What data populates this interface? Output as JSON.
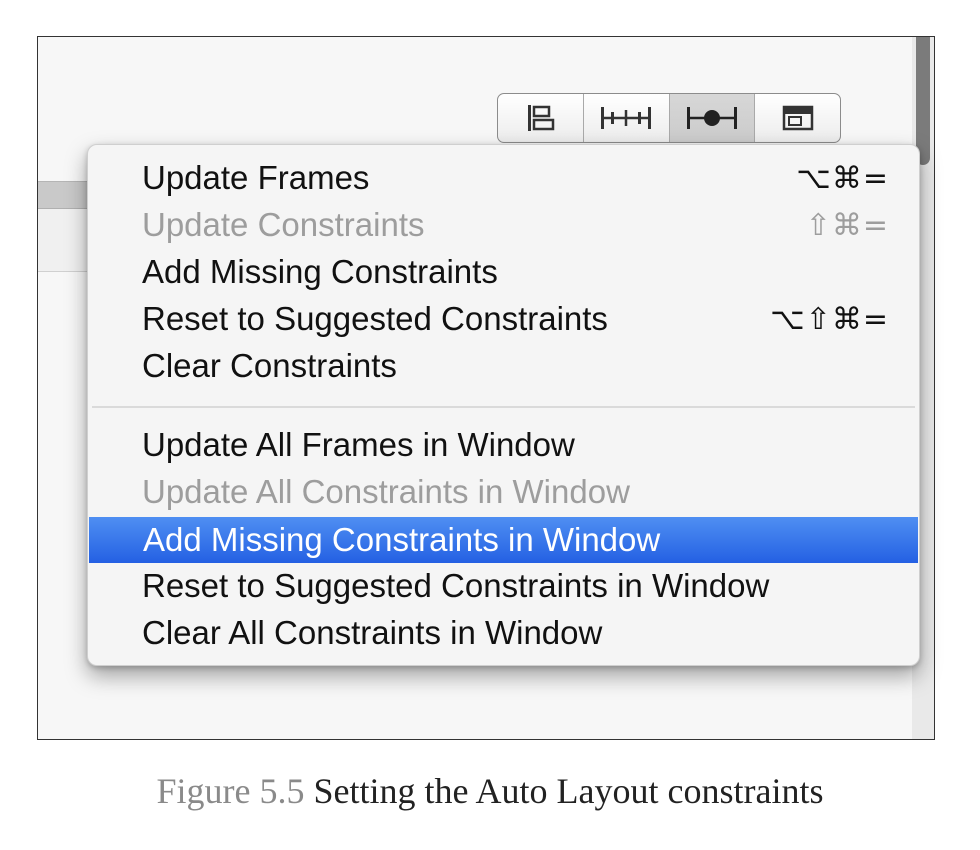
{
  "toolbar": {
    "buttons": [
      {
        "icon": "align-icon"
      },
      {
        "icon": "pin-icon"
      },
      {
        "icon": "resolve-auto-layout-icon",
        "active": true
      },
      {
        "icon": "resizing-behavior-icon"
      }
    ]
  },
  "menu": {
    "items": [
      {
        "label": "Update Frames",
        "shortcut": "⌥⌘=",
        "enabled": true
      },
      {
        "label": "Update Constraints",
        "shortcut": "⇧⌘=",
        "enabled": false
      },
      {
        "label": "Add Missing Constraints",
        "shortcut": "",
        "enabled": true
      },
      {
        "label": "Reset to Suggested Constraints",
        "shortcut": "⌥⇧⌘=",
        "enabled": true
      },
      {
        "label": "Clear Constraints",
        "shortcut": "",
        "enabled": true
      },
      {
        "label": "Update All Frames in Window",
        "shortcut": "",
        "enabled": true
      },
      {
        "label": "Update All Constraints in Window",
        "shortcut": "",
        "enabled": false
      },
      {
        "label": "Add Missing Constraints in Window",
        "shortcut": "",
        "enabled": true,
        "selected": true
      },
      {
        "label": "Reset to Suggested Constraints in Window",
        "shortcut": "",
        "enabled": true
      },
      {
        "label": "Clear All Constraints in Window",
        "shortcut": "",
        "enabled": true
      }
    ]
  },
  "caption": {
    "figure_number": "Figure 5.5",
    "text": "Setting the Auto Layout constraints"
  },
  "colors": {
    "selection": "#2f6ee8",
    "disabled_text": "#9d9d9d",
    "menu_background": "#f5f5f5"
  }
}
